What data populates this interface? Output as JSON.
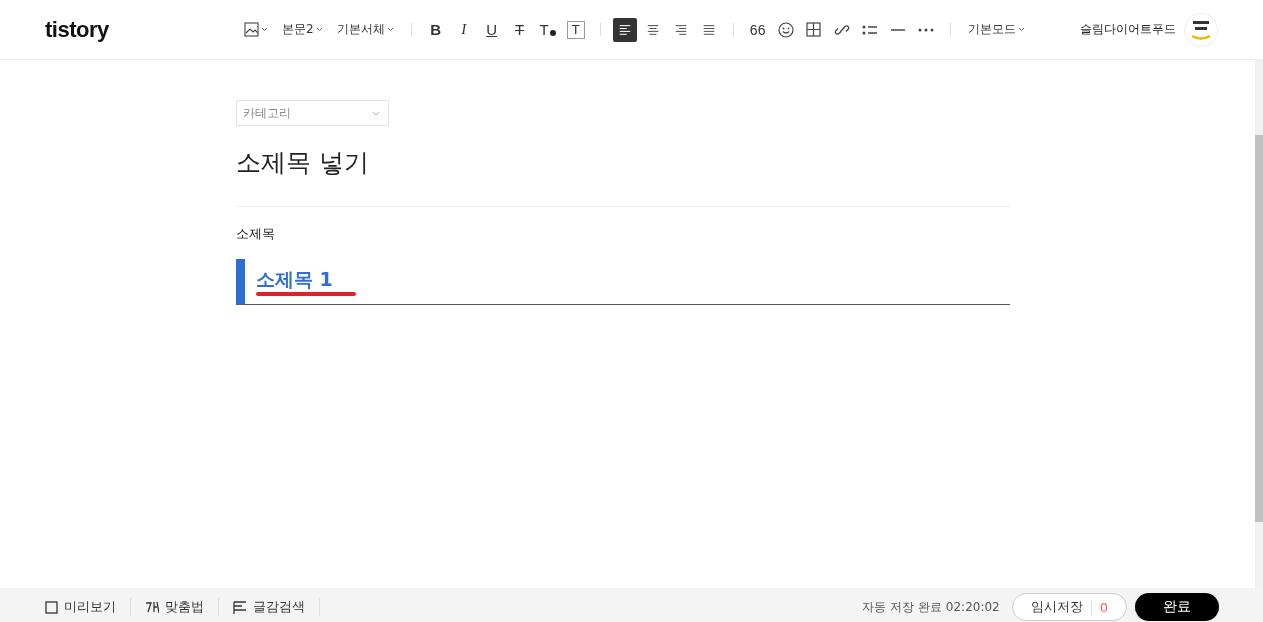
{
  "header": {
    "logo": "tistory",
    "user_name": "슬림다이어트푸드"
  },
  "toolbar": {
    "dropdowns": [
      {
        "kind": "image"
      },
      {
        "kind": "text",
        "label": "본문2"
      },
      {
        "kind": "text",
        "label": "기본서체"
      }
    ],
    "format_buttons": [
      {
        "kind": "bold",
        "label": "B"
      },
      {
        "kind": "italic",
        "label": "I"
      },
      {
        "kind": "underline",
        "label": "U"
      },
      {
        "kind": "strike",
        "label": "T"
      },
      {
        "kind": "color",
        "label": "T"
      },
      {
        "kind": "background",
        "label": "T"
      }
    ],
    "align_buttons": [
      {
        "kind": "left",
        "selected": true
      },
      {
        "kind": "center",
        "selected": false
      },
      {
        "kind": "right",
        "selected": false
      },
      {
        "kind": "justify",
        "selected": false
      }
    ],
    "insert_buttons": [
      {
        "kind": "quote",
        "label": "66"
      },
      {
        "kind": "emoji"
      },
      {
        "kind": "table"
      },
      {
        "kind": "link"
      },
      {
        "kind": "list"
      },
      {
        "kind": "rule"
      },
      {
        "kind": "more"
      }
    ],
    "mode": "기본모드"
  },
  "editor": {
    "category_placeholder": "카테고리",
    "title": "소제목 넣기",
    "blocks": [
      {
        "kind": "paragraph",
        "text": "소제목"
      },
      {
        "kind": "heading",
        "text": "소제목 1"
      }
    ]
  },
  "footer": {
    "left": [
      {
        "kind": "preview",
        "label": "미리보기"
      },
      {
        "kind": "spell",
        "label": "맞춤법"
      },
      {
        "kind": "search",
        "label": "글감검색"
      }
    ],
    "autosave": "자동 저장 완료 02:20:02",
    "draft": "임시저장",
    "draft_count": "0",
    "publish": "완료"
  }
}
